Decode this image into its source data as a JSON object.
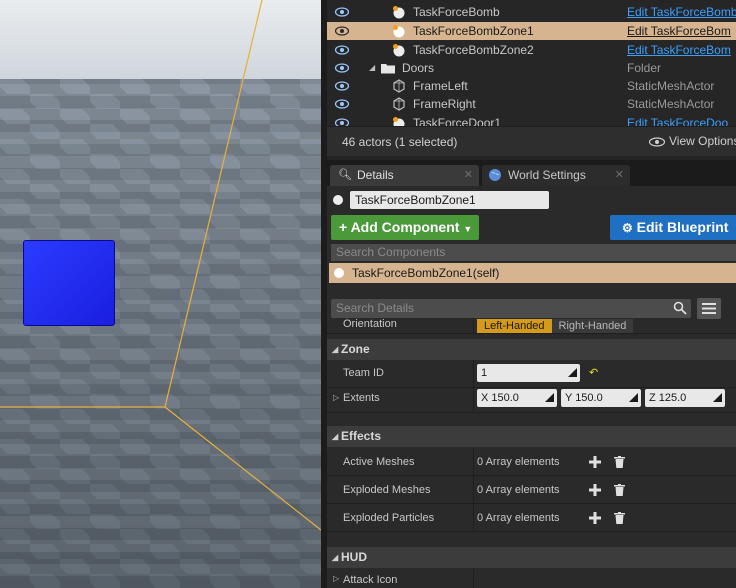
{
  "outliner": {
    "rows": [
      {
        "name": "TaskForceBomb",
        "type": "Edit TaskForceBomb"
      },
      {
        "name": "TaskForceBombZone1",
        "type": "Edit TaskForceBom"
      },
      {
        "name": "TaskForceBombZone2",
        "type": "Edit TaskForceBom"
      },
      {
        "name": "Doors",
        "type": "Folder"
      },
      {
        "name": "FrameLeft",
        "type": "StaticMeshActor"
      },
      {
        "name": "FrameRight",
        "type": "StaticMeshActor"
      },
      {
        "name": "TaskForceDoor1",
        "type": "Edit TaskForceDoo"
      }
    ],
    "actor_count": "46 actors (1 selected)",
    "view_options": "View Options"
  },
  "tabs": {
    "details": "Details",
    "world_settings": "World Settings"
  },
  "details": {
    "actor_name": "TaskForceBombZone1",
    "add_component": "Add Component",
    "edit_blueprint": "Edit Blueprint",
    "search_components_placeholder": "Search Components",
    "component_self": "TaskForceBombZone1(self)",
    "search_details_placeholder": "Search Details"
  },
  "properties": {
    "orientation": {
      "label": "Orientation",
      "options": [
        "Left-Handed",
        "Right-Handed"
      ],
      "selected": "Left-Handed"
    },
    "zone": {
      "category": "Zone",
      "team_id": {
        "label": "Team ID",
        "value": "1"
      },
      "extents": {
        "label": "Extents",
        "x": "X  150.0",
        "y": "Y  150.0",
        "z": "Z  125.0"
      }
    },
    "effects": {
      "category": "Effects",
      "active_meshes": {
        "label": "Active Meshes",
        "value": "0 Array elements"
      },
      "exploded_meshes": {
        "label": "Exploded Meshes",
        "value": "0 Array elements"
      },
      "exploded_particles": {
        "label": "Exploded Particles",
        "value": "0 Array elements"
      }
    },
    "hud": {
      "category": "HUD",
      "attack_icon": {
        "label": "Attack Icon"
      }
    }
  },
  "colors": {
    "selection": "#d6b48f",
    "add_component": "#4a9a3a",
    "edit_blueprint": "#1f6fc2",
    "link": "#3aa0ff",
    "active_radio": "#d49a1a",
    "zone_box": "#2b3cff"
  }
}
